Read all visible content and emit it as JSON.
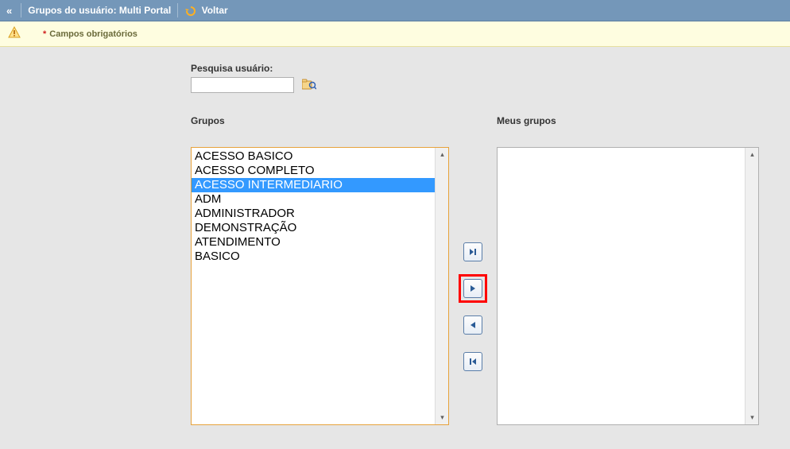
{
  "header": {
    "title": "Grupos do usuário: Multi Portal",
    "back_label": "Voltar"
  },
  "notice": {
    "text": "Campos obrigatórios"
  },
  "search": {
    "label": "Pesquisa usuário:",
    "value": ""
  },
  "left_list": {
    "label": "Grupos",
    "items": [
      {
        "text": "ACESSO BASICO",
        "selected": false
      },
      {
        "text": "ACESSO COMPLETO",
        "selected": false
      },
      {
        "text": "ACESSO INTERMEDIARIO",
        "selected": true
      },
      {
        "text": "ADM",
        "selected": false
      },
      {
        "text": "ADMINISTRADOR",
        "selected": false
      },
      {
        "text": "DEMONSTRAÇÃO",
        "selected": false
      },
      {
        "text": "ATENDIMENTO",
        "selected": false
      },
      {
        "text": "BASICO",
        "selected": false
      }
    ]
  },
  "right_list": {
    "label": "Meus grupos",
    "items": []
  },
  "highlight": {
    "target": "move-right-button"
  }
}
